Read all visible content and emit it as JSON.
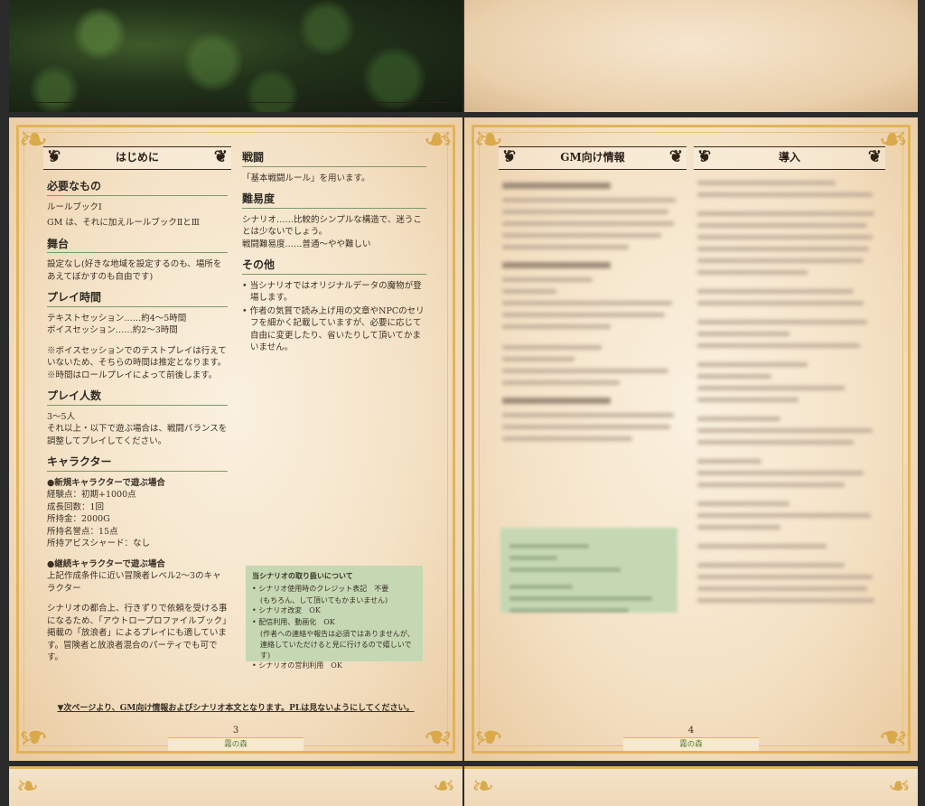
{
  "page3": {
    "intro_banner": "はじめに",
    "sections": {
      "needs_title": "必要なもの",
      "needs_1": "ルールブックⅠ",
      "needs_2": "GM は、それに加えルールブックⅡとⅢ",
      "stage_title": "舞台",
      "stage_text": "設定なし(好きな地域を設定するのも、場所をあえてぼかすのも自由です)",
      "time_title": "プレイ時間",
      "time_1": "テキストセッション……約4～5時間",
      "time_2": "ボイスセッション……約2～3時間",
      "time_note_1": "※ボイスセッションでのテストプレイは行えていないため、そちらの時間は推定となります。",
      "time_note_2": "※時間はロールプレイによって前後します。",
      "players_title": "プレイ人数",
      "players_1": "3～5人",
      "players_2": "それ以上・以下で遊ぶ場合は、戦闘バランスを調整してプレイしてください。",
      "character_title": "キャラクター",
      "new_char_title": "●新規キャラクターで遊ぶ場合",
      "new_char_lines": [
        "経験点：初期+1000点",
        "成長回数：1回",
        "所持金：2000G",
        "所持名誉点：15点",
        "所持アビスシャード：なし"
      ],
      "cont_char_title": "●継続キャラクターで遊ぶ場合",
      "cont_char_text": "上記作成条件に近い冒険者レベル2～3のキャラクター",
      "cont_char_note": "シナリオの都合上、行きずりで依頼を受ける事になるため、「アウトロープロファイルブック」掲載の「放浪者」によるプレイにも適しています。冒険者と放浪者混合のパーティでも可です。",
      "battle_title": "戦闘",
      "battle_text": "「基本戦闘ルール」を用います。",
      "difficulty_title": "難易度",
      "difficulty_1": "シナリオ……比較的シンプルな構造で、迷うことは少ないでしょう。",
      "difficulty_2": "戦闘難易度……普通～やや難しい",
      "other_title": "その他",
      "other_items": [
        "当シナリオではオリジナルデータの魔物が登場します。",
        "作者の気質で読み上げ用の文章やNPCのセリフを細かく記載していますが、必要に応じて自由に変更したり、省いたりして頂いてかまいません。"
      ]
    },
    "notice": {
      "title": "当シナリオの取り扱いについて",
      "items": [
        "シナリオ使用時のクレジット表記　不要",
        "(もちろん、して頂いてもかまいません)",
        "シナリオ改変　OK",
        "配信利用、動画化　OK",
        "(作者への連絡や報告は必須ではありませんが、連絡していただけると見に行けるので嬉しいです)",
        "シナリオの営利利用　OK"
      ]
    },
    "footer_note": "▼次ページより、GM向け情報およびシナリオ本文となります。PLは見ないようにしてください。",
    "page_number": "3",
    "book_title": "霧の森"
  },
  "page4": {
    "gm_banner": "GM向け情報",
    "intro_banner": "導入",
    "page_number": "4",
    "book_title": "霧の森"
  },
  "colors": {
    "frame_gold": "#e2b35a",
    "parchment": "#f4e2c6",
    "notice_green": "#c5d8b3",
    "heading_rule": "#7a9a6a"
  },
  "icons": [
    "ornament-corner-icon",
    "flourish-icon"
  ]
}
